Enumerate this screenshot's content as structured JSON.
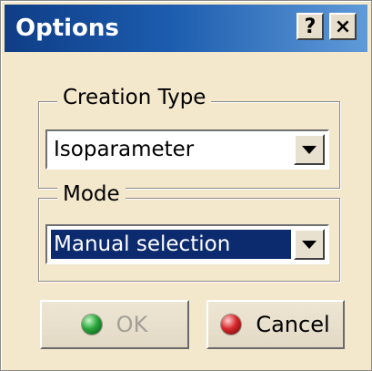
{
  "window": {
    "title": "Options",
    "help_button": "?",
    "close_button": "×"
  },
  "creation_type": {
    "legend": "Creation Type",
    "selected_value": "Isoparameter"
  },
  "mode": {
    "legend": "Mode",
    "selected_value": "Manual selection"
  },
  "buttons": {
    "ok_label": "OK",
    "ok_enabled": false,
    "cancel_label": "Cancel"
  },
  "colors": {
    "dialog_background": "#f3e7cc",
    "titlebar_start": "#0f3d86",
    "titlebar_end": "#5f9ad8",
    "selection_highlight": "#0c2a6e",
    "ok_icon": "#29a63a",
    "cancel_icon": "#d8262a"
  },
  "icons": {
    "ok_icon": "green-orb-icon",
    "cancel_icon": "red-orb-icon",
    "dropdown_icon": "triangle-down-icon"
  }
}
